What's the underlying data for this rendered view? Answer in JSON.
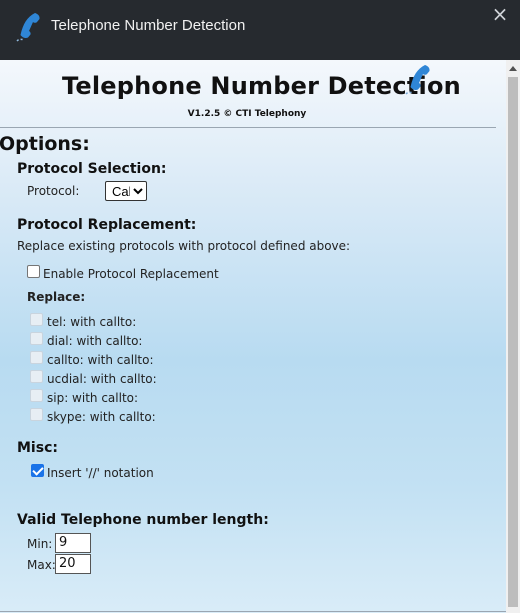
{
  "window": {
    "title": "Telephone Number Detection",
    "close_glyph": "×"
  },
  "header": {
    "title": "Telephone Number Detection",
    "version": "V1.2.5 © CTI Telephony"
  },
  "options": {
    "heading": "Options:",
    "protocol_selection": {
      "heading": "Protocol Selection:",
      "label": "Protocol:",
      "selected": "CallTo:"
    },
    "protocol_replacement": {
      "heading": "Protocol Replacement:",
      "description": "Replace existing protocols with protocol defined above:",
      "enable_label": "Enable Protocol Replacement",
      "enable_checked": false,
      "replace_heading": "Replace:",
      "items": [
        {
          "label": "tel: with callto:",
          "checked": false,
          "disabled": true
        },
        {
          "label": "dial: with callto:",
          "checked": false,
          "disabled": true
        },
        {
          "label": "callto: with callto:",
          "checked": false,
          "disabled": true
        },
        {
          "label": "ucdial: with callto:",
          "checked": false,
          "disabled": true
        },
        {
          "label": "sip: with callto:",
          "checked": false,
          "disabled": true
        },
        {
          "label": "skype: with callto:",
          "checked": false,
          "disabled": true
        }
      ]
    },
    "misc": {
      "heading": "Misc:",
      "notation_label": "Insert '//' notation",
      "notation_checked": true
    },
    "length": {
      "heading": "Valid Telephone number length:",
      "min_label": "Min:",
      "min_value": "9",
      "max_label": "Max:",
      "max_value": "20"
    }
  },
  "icons": {
    "app": "telephone-handset-icon",
    "close": "close-icon"
  },
  "colors": {
    "titlebar": "#262a2f",
    "checkbox_accent": "#1a73e8"
  }
}
